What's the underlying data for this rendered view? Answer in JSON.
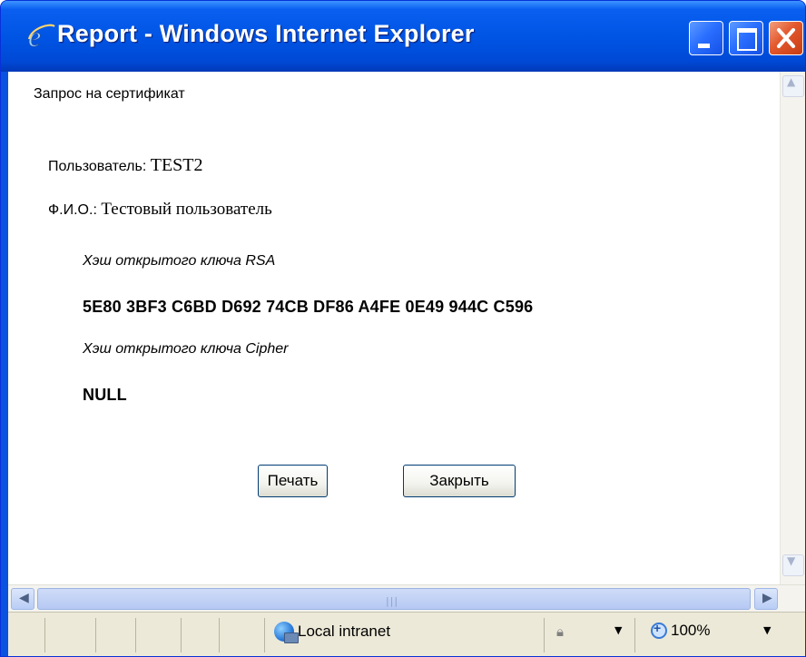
{
  "window": {
    "title": "Report - Windows Internet Explorer"
  },
  "document": {
    "heading": "Запрос на сертификат",
    "user_label": "Пользователь:",
    "user_value": "TEST2",
    "fio_label": "Ф.И.О.:",
    "fio_value": "Тестовый пользователь",
    "rsa_label": "Хэш открытого ключа RSA",
    "rsa_value": "5E80 3BF3 C6BD D692 74CB DF86 A4FE 0E49 944C C596",
    "cipher_label": "Хэш открытого ключа Cipher",
    "cipher_value": "NULL"
  },
  "buttons": {
    "print": "Печать",
    "close": "Закрыть"
  },
  "statusbar": {
    "zone": "Local intranet",
    "zoom": "100%"
  },
  "colors": {
    "titlebar": "#0055e5",
    "close_button": "#e3572c",
    "statusbar": "#ece9d8"
  }
}
